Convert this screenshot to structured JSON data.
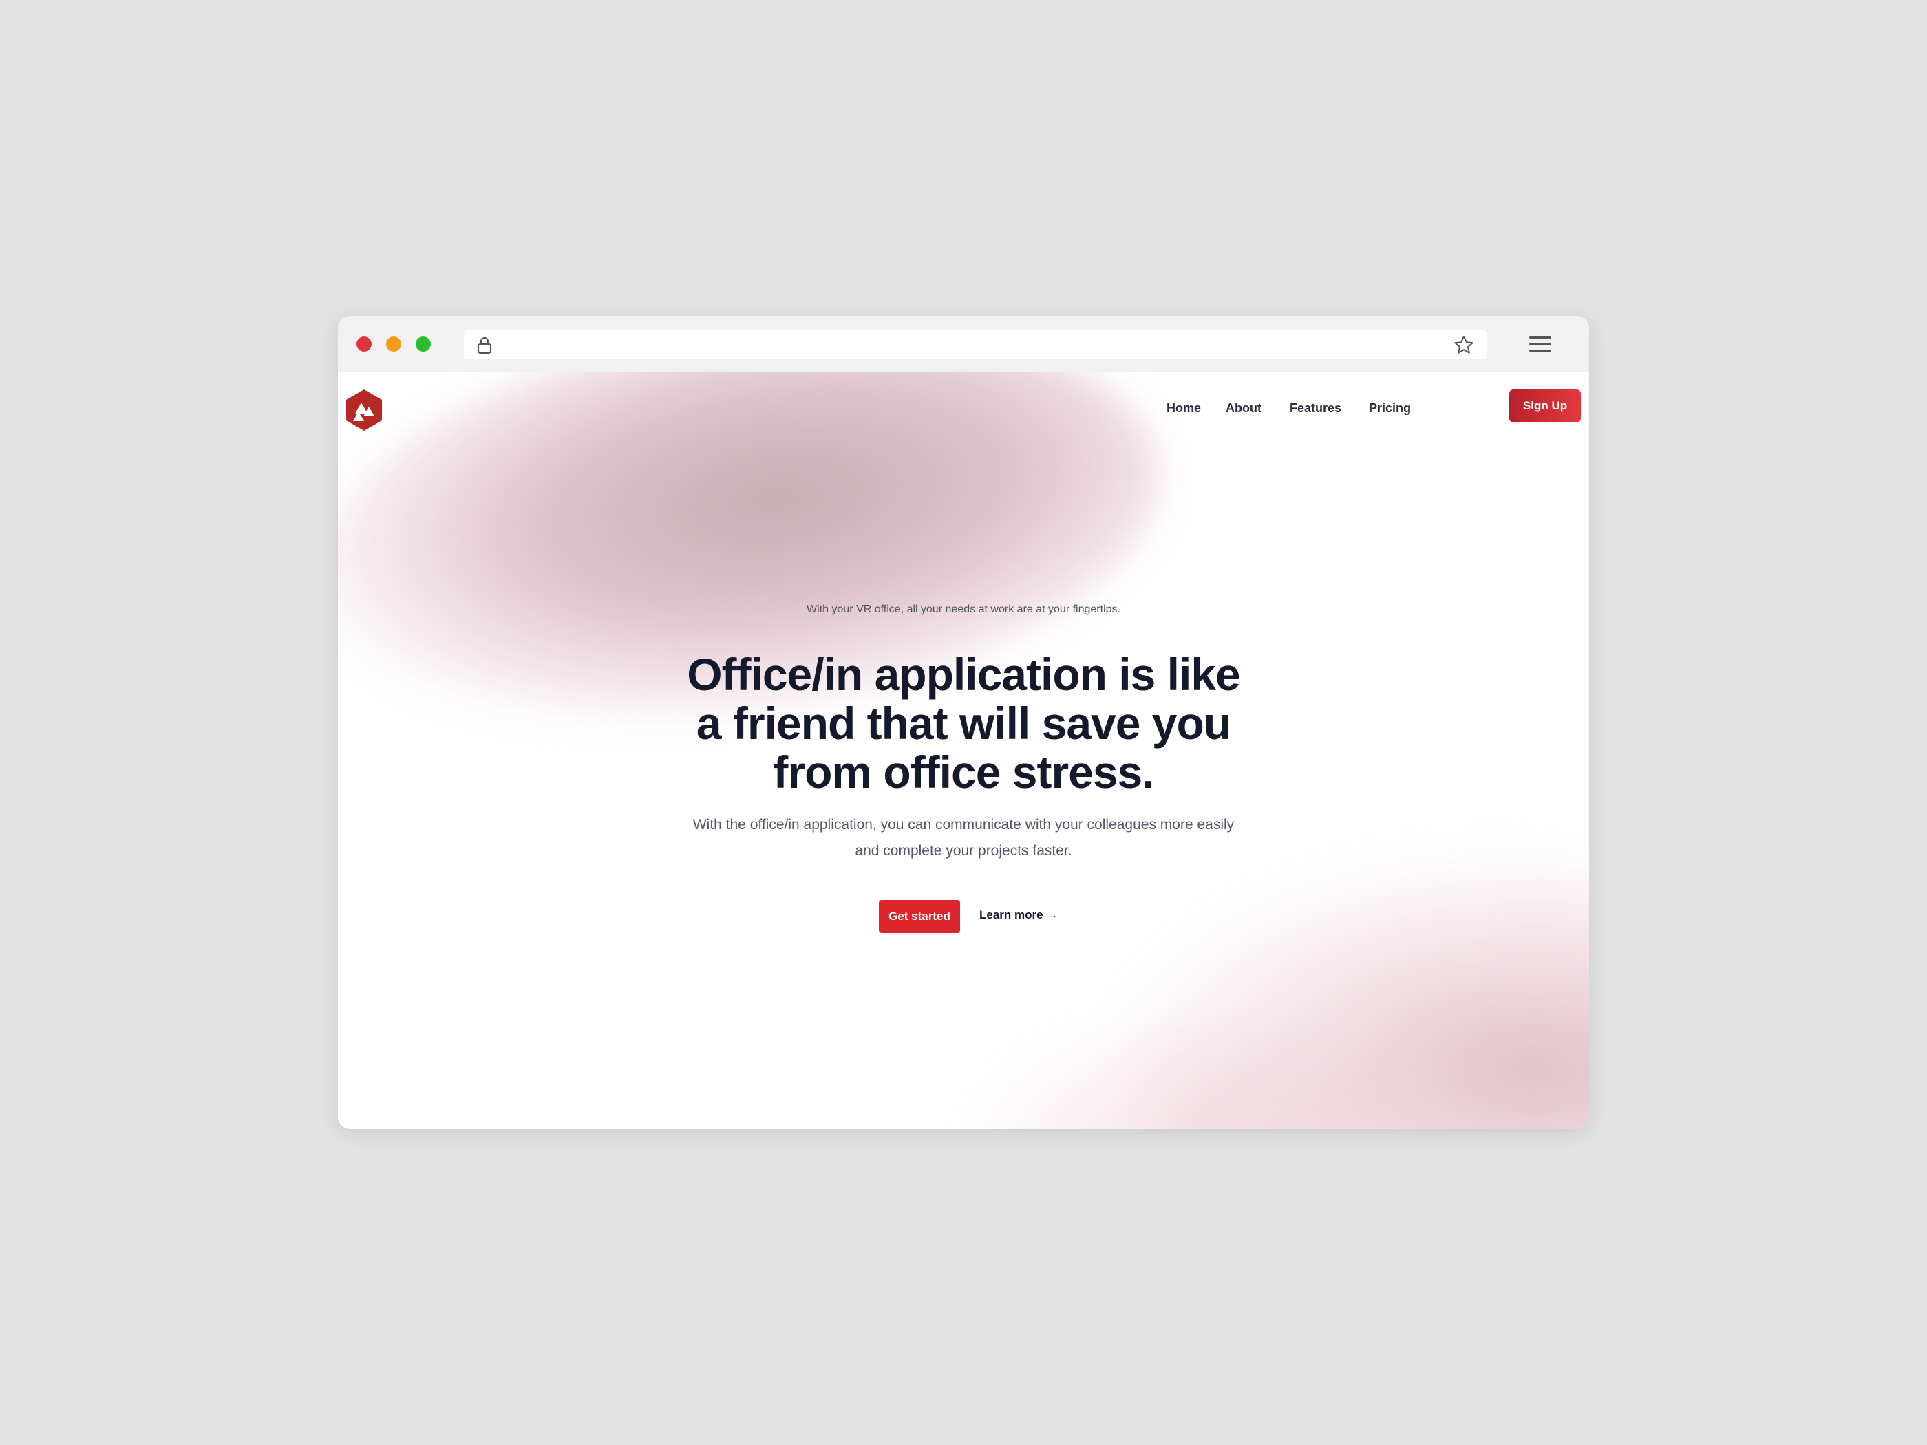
{
  "browser": {
    "url": "",
    "window_controls": [
      "close",
      "minimize",
      "maximize"
    ],
    "icons": {
      "lock": "lock-icon",
      "bookmark": "star-icon",
      "menu": "hamburger-menu-icon"
    }
  },
  "site": {
    "logo_icon": "hexagon-logo-icon",
    "nav": {
      "items": [
        {
          "label": "Home"
        },
        {
          "label": "About"
        },
        {
          "label": "Features"
        },
        {
          "label": "Pricing"
        }
      ]
    },
    "signup_label": "Sign Up"
  },
  "hero": {
    "eyebrow": "With your VR office, all your needs at work are at your fingertips.",
    "headline": "Office/in application is like a friend that will save you from office stress.",
    "subtext": "With the office/in application, you can communicate with your colleagues more easily and complete your projects faster.",
    "primary_cta": "Get started",
    "secondary_cta": "Learn more →"
  },
  "colors": {
    "accent": "#dc262c",
    "accent_dark": "#b8212a",
    "heading": "#141a2b",
    "body_text": "#505766",
    "backdrop": "#e2e2e2"
  }
}
